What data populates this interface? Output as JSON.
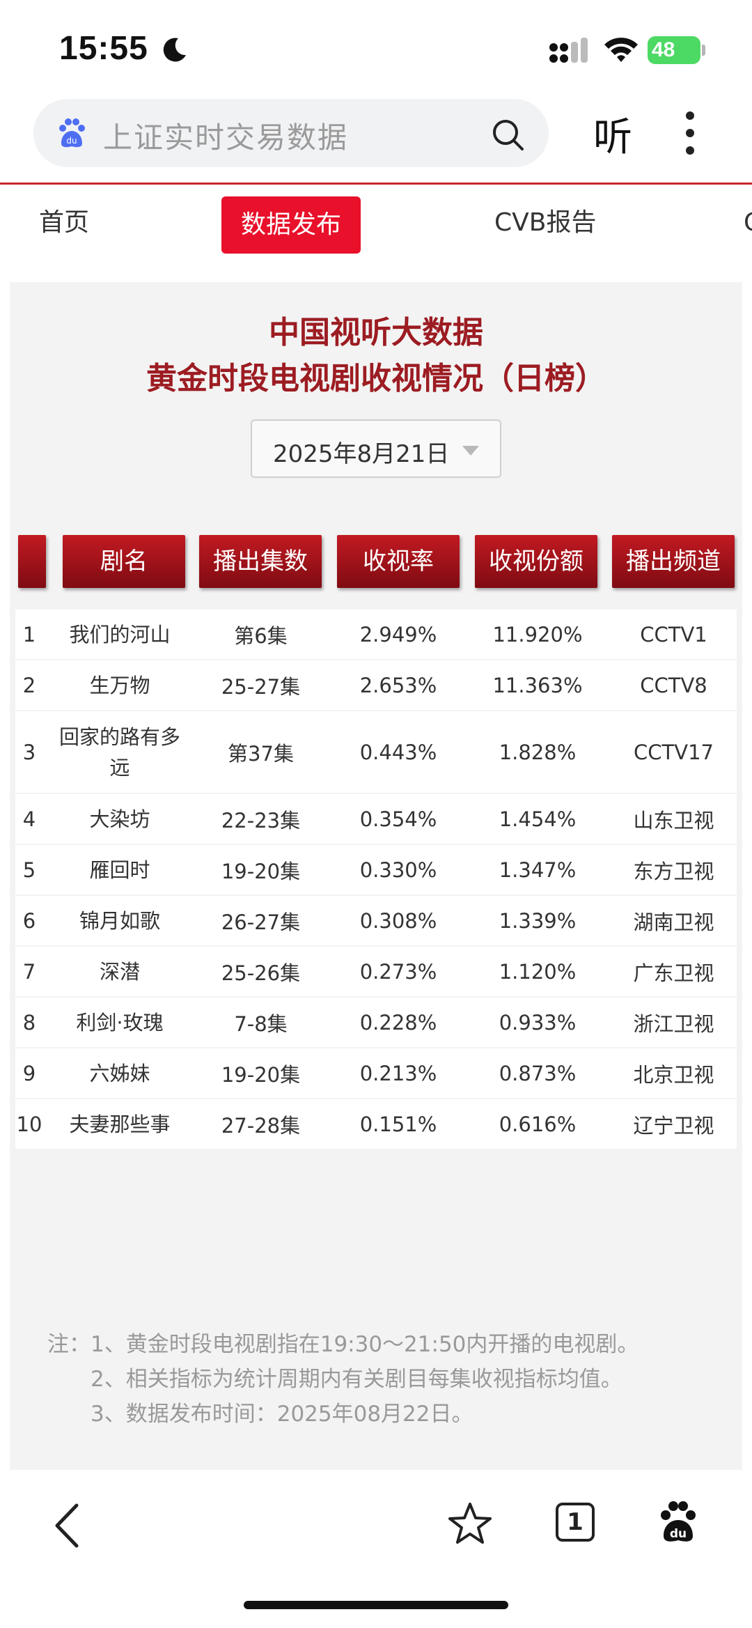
{
  "status_bar": {
    "time": "15:55",
    "battery": "48"
  },
  "search": {
    "query": "上证实时交易数据",
    "listen_label": "听"
  },
  "nav": {
    "items": [
      "首页",
      "数据发布",
      "CVB报告",
      "C"
    ]
  },
  "report": {
    "title_line1": "中国视听大数据",
    "title_line2": "黄金时段电视剧收视情况（日榜）",
    "date": "2025年8月21日",
    "headers": [
      "",
      "剧名",
      "播出集数",
      "收视率",
      "收视份额",
      "播出频道"
    ],
    "rows": [
      {
        "rank": "1",
        "name": "我们的河山",
        "episodes": "第6集",
        "rating": "2.949%",
        "share": "11.920%",
        "channel": "CCTV1"
      },
      {
        "rank": "2",
        "name": "生万物",
        "episodes": "25-27集",
        "rating": "2.653%",
        "share": "11.363%",
        "channel": "CCTV8"
      },
      {
        "rank": "3",
        "name": "回家的路有多远",
        "episodes": "第37集",
        "rating": "0.443%",
        "share": "1.828%",
        "channel": "CCTV17"
      },
      {
        "rank": "4",
        "name": "大染坊",
        "episodes": "22-23集",
        "rating": "0.354%",
        "share": "1.454%",
        "channel": "山东卫视"
      },
      {
        "rank": "5",
        "name": "雁回时",
        "episodes": "19-20集",
        "rating": "0.330%",
        "share": "1.347%",
        "channel": "东方卫视"
      },
      {
        "rank": "6",
        "name": "锦月如歌",
        "episodes": "26-27集",
        "rating": "0.308%",
        "share": "1.339%",
        "channel": "湖南卫视"
      },
      {
        "rank": "7",
        "name": "深潜",
        "episodes": "25-26集",
        "rating": "0.273%",
        "share": "1.120%",
        "channel": "广东卫视"
      },
      {
        "rank": "8",
        "name": "利剑·玫瑰",
        "episodes": "7-8集",
        "rating": "0.228%",
        "share": "0.933%",
        "channel": "浙江卫视"
      },
      {
        "rank": "9",
        "name": "六姊妹",
        "episodes": "19-20集",
        "rating": "0.213%",
        "share": "0.873%",
        "channel": "北京卫视"
      },
      {
        "rank": "10",
        "name": "夫妻那些事",
        "episodes": "27-28集",
        "rating": "0.151%",
        "share": "0.616%",
        "channel": "辽宁卫视"
      }
    ],
    "notes": [
      "注：1、黄金时段电视剧指在19:30～21:50内开播的电视剧。",
      "2、相关指标为统计周期内有关剧目每集收视指标均值。",
      "3、数据发布时间：2025年08月22日。"
    ]
  },
  "bottom_bar": {
    "tabs_count": "1"
  },
  "colors": {
    "accent": "#e8102a",
    "title": "#9c1c22",
    "header_top": "#c21a22",
    "header_bottom": "#7f0b12"
  }
}
